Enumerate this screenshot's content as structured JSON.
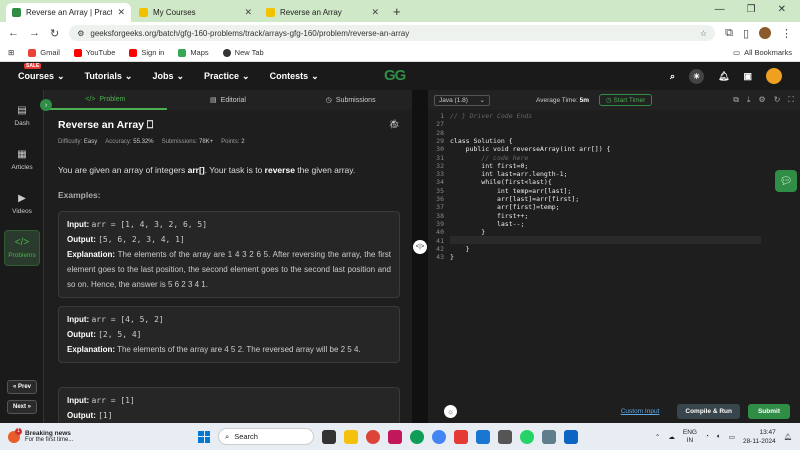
{
  "browser": {
    "tabs": [
      {
        "title": "Reverse an Array | Practice | Ge",
        "active": true
      },
      {
        "title": "My Courses",
        "active": false
      },
      {
        "title": "Reverse an Array",
        "active": false
      }
    ],
    "new_tab": "+",
    "url": "geeksforgeeks.org/batch/gfg-160-problems/track/arrays-gfg-160/problem/reverse-an-array",
    "bookmarks": [
      {
        "label": "Gmail",
        "color": "#ea4335"
      },
      {
        "label": "YouTube",
        "color": "#ff0000"
      },
      {
        "label": "Sign in",
        "color": "#ff0000"
      },
      {
        "label": "Maps",
        "color": "#34a853"
      },
      {
        "label": "New Tab",
        "color": "#333333"
      }
    ],
    "all_bookmarks": "All Bookmarks"
  },
  "header": {
    "sale": "SALE",
    "nav": [
      "Courses",
      "Tutorials",
      "Jobs",
      "Practice",
      "Contests"
    ],
    "logo": "GG"
  },
  "rail": {
    "items": [
      {
        "label": "Dash",
        "icon": "▤"
      },
      {
        "label": "Articles",
        "icon": "▦"
      },
      {
        "label": "Videos",
        "icon": "▶"
      },
      {
        "label": "Problems",
        "icon": "</>"
      }
    ],
    "prev": "« Prev",
    "next": "Next »"
  },
  "problem_tabs": {
    "problem": "Problem",
    "editorial": "Editorial",
    "submissions": "Submissions"
  },
  "problem": {
    "title": "Reverse an Array",
    "difficulty_label": "Difficulty:",
    "difficulty": "Easy",
    "accuracy_label": "Accuracy:",
    "accuracy": "55.32%",
    "submissions_label": "Submissions:",
    "submissions": "78K+",
    "points_label": "Points:",
    "points": "2",
    "desc_pre": "You are given an array of integers ",
    "desc_arr": "arr[]",
    "desc_mid": ". Your task is to ",
    "desc_rev": "reverse",
    "desc_post": " the given array.",
    "examples_heading": "Examples:",
    "input_label": "Input:",
    "output_label": "Output:",
    "explanation_label": "Explanation:",
    "examples": [
      {
        "input": "arr = [1, 4, 3, 2, 6, 5]",
        "output": "[5, 6, 2, 3, 4, 1]",
        "explanation": "The elements of the array are 1 4 3 2 6 5. After reversing the array, the first element goes to the last position, the second element goes to the second last position and so on. Hence, the answer is 5 6 2 3 4 1."
      },
      {
        "input": "arr = [4, 5, 2]",
        "output": "[2, 5, 4]",
        "explanation": "The elements of the array are 4 5 2. The reversed array will be 2 5 4."
      },
      {
        "input": "arr = [1]",
        "output": "[1]"
      }
    ]
  },
  "editor": {
    "language": "Java (1.8)",
    "avg_time_label": "Average Time:",
    "avg_time": "5m",
    "start_timer": "Start Timer",
    "line_numbers": [
      "1",
      "27",
      "28",
      "29",
      "30",
      "31",
      "32",
      "33",
      "34",
      "35",
      "36",
      "37",
      "38",
      "39",
      "40",
      "41",
      "42",
      "43"
    ],
    "code_lines": [
      "// } Driver Code Ends",
      "",
      "",
      "class Solution {",
      "    public void reverseArray(int arr[]) {",
      "        // code here",
      "        int first=0;",
      "        int last=arr.length-1;",
      "        while(first<last){",
      "            int temp=arr[last];",
      "            arr[last]=arr[first];",
      "            arr[first]=temp;",
      "            first++;",
      "            last--;",
      "        }",
      "",
      "    }",
      "}"
    ],
    "custom_input": "Custom Input",
    "compile": "Compile & Run",
    "submit": "Submit"
  },
  "taskbar": {
    "news_title": "Breaking news",
    "news_sub": "For the first time...",
    "news_badge": "1",
    "search": "Search",
    "lang_top": "ENG",
    "lang_bottom": "IN",
    "time": "13:47",
    "date": "28-11-2024"
  },
  "colors": {
    "accent": "#2f8d46"
  }
}
